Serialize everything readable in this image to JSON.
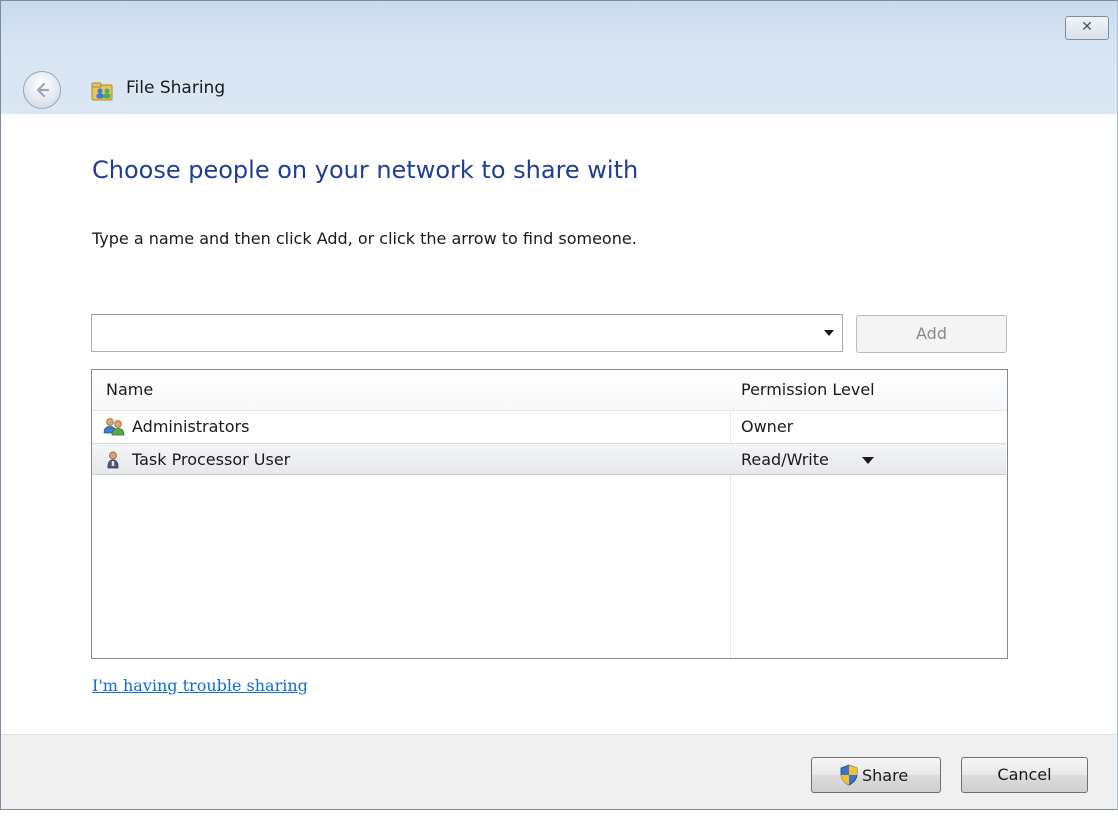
{
  "window": {
    "title": "File Sharing",
    "close_symbol": "✕"
  },
  "main": {
    "heading": "Choose people on your network to share with",
    "instruction": "Type a name and then click Add, or click the arrow to find someone.",
    "name_input": {
      "value": "",
      "placeholder": ""
    },
    "add_label": "Add"
  },
  "list": {
    "columns": [
      "Name",
      "Permission Level"
    ],
    "rows": [
      {
        "name": "Administrators",
        "permission": "Owner",
        "icon": "group-icon",
        "selected": false
      },
      {
        "name": "Task Processor User",
        "permission": "Read/Write",
        "icon": "user-icon",
        "selected": true
      }
    ]
  },
  "help_link": "I'm having trouble sharing",
  "footer": {
    "share_label": "Share",
    "cancel_label": "Cancel"
  },
  "colors": {
    "heading": "#1f3f95",
    "link": "#0f6bd6",
    "chrome": "#d7e4f2"
  }
}
